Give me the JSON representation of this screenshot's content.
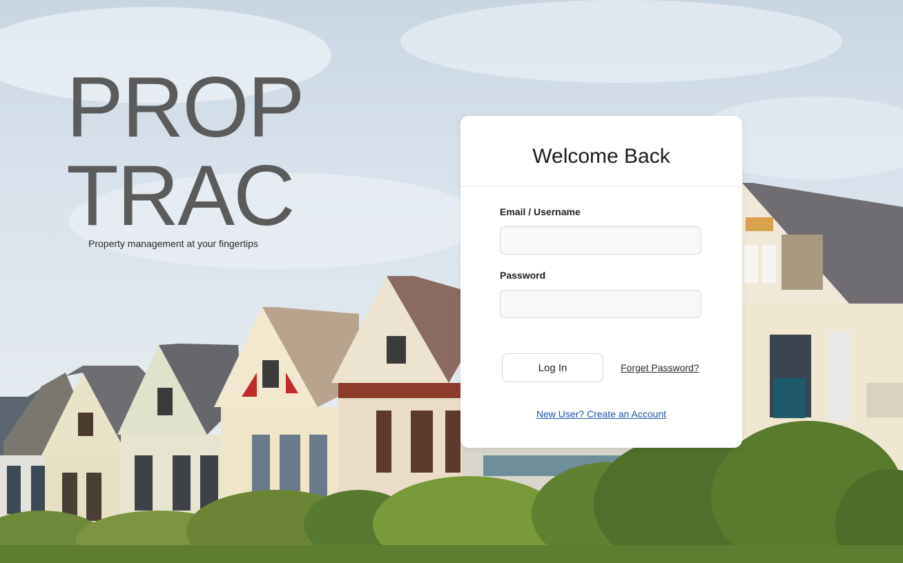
{
  "brand": {
    "line1": "PROP",
    "line2": "TRAC",
    "tagline": "Property management at your fingertips"
  },
  "login": {
    "title": "Welcome Back",
    "email_label": "Email / Username",
    "email_value": "",
    "password_label": "Password",
    "password_value": "",
    "login_button": "Log In",
    "forgot_link": "Forget Password?",
    "create_account_link": "New User? Create an Account"
  },
  "colors": {
    "brand_text": "#5b5b5b",
    "link_blue": "#1d4fa3",
    "card_bg": "#ffffff"
  }
}
